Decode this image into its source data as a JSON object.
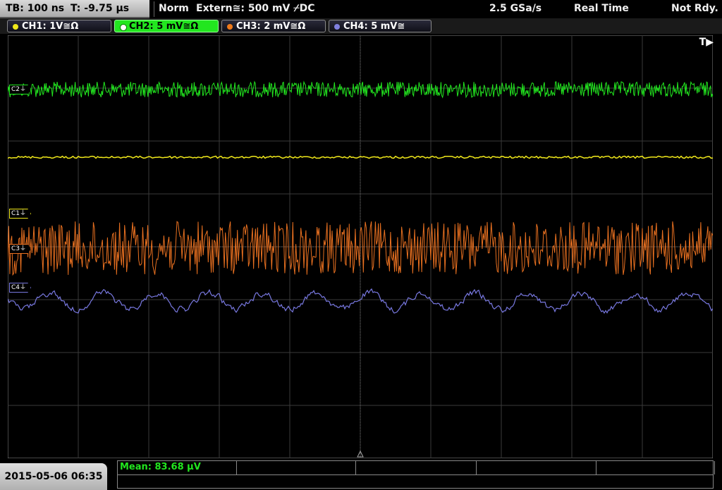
{
  "header": {
    "timebase": "TB: 100 ns",
    "trigger_time": "T: -9.75 µs",
    "mode": "Norm",
    "trigger_source": "Extern≅: 500 mV ⌿DC",
    "sample_rate": "2.5 GSa/s",
    "acquire_mode": "Real Time",
    "status": "Not Rdy."
  },
  "channels": [
    {
      "label": "CH1: 1V≅Ω",
      "color": "#f0e81a",
      "active": false
    },
    {
      "label": "CH2: 5 mV≅Ω",
      "color": "#22e61f",
      "active": true
    },
    {
      "label": "CH3: 2 mV≅Ω",
      "color": "#f07a1a",
      "active": false
    },
    {
      "label": "CH4: 5 mV≅",
      "color": "#8080e0",
      "active": false
    }
  ],
  "trigger_marker": "T▶",
  "channel_markers": {
    "c1": "C1⏚",
    "c2": "C2⏚",
    "c3": "C3⏚",
    "c4": "C4⏚"
  },
  "measurement": {
    "mean": "Mean: 83.68 µV"
  },
  "footer": {
    "datetime": "2015-05-06 06:35"
  },
  "colors": {
    "ch1": "#f0e81a",
    "ch2": "#22e61f",
    "ch3": "#e87020",
    "ch4": "#7878e0",
    "grid": "#3a3a3a"
  }
}
